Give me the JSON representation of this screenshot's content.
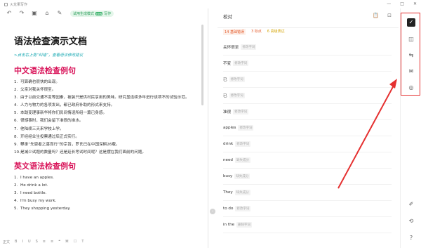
{
  "window": {
    "app_title": "火龙果写作",
    "controls": [
      "—",
      "□",
      "✕"
    ]
  },
  "toolbar": {
    "icons": [
      "undo-icon",
      "redo-icon",
      "image-icon",
      "format-icon",
      "brush-icon"
    ],
    "pill_label": "试用生成模式",
    "pill_badge": "new",
    "pill_suffix": "写作"
  },
  "document": {
    "title": "语法检查演示文档",
    "hint": ">点击右上角“纠错”，查看语法修改建议",
    "section_cn": "中文语法检查例句",
    "cn_items": [
      "可算确也很快的出现。",
      "父亲对我关怀很至。",
      "由于以前交通不变等因素，被装只是供村民享用的美味。研究显连续多年进行该项不的试验示范。",
      "人力与物力的各项发出，都已政府补助的形式来支持。",
      "本践变理事新华将你们民间情谊所组一篇已身感。",
      "很憾事时，我们会留下准很的准水。",
      "他陆续三天来学校上学。",
      "开经经业生投票通过后正式实行。",
      "攀承“先恩者之喜而行”的宗旨，罗氏已在中国深耕26载。",
      "是减少试题的数量吗？还是延长考试时间呢？这是摆在我们面前的问题。"
    ],
    "section_en": "英文语法检查例句",
    "en_items": [
      "I have an apples.",
      "He drink a lot.",
      "I need bottle.",
      "I'm busy my work.",
      "They shopping yesterday."
    ]
  },
  "bottombar": [
    "正文",
    "B",
    "I",
    "U",
    "S",
    "≡",
    "≡",
    "❝",
    "⌘",
    "☐",
    "T"
  ],
  "panel": {
    "title": "校对",
    "stats": [
      {
        "count": "14",
        "label": "基础错误"
      },
      {
        "count": "3",
        "label": "标点"
      },
      {
        "count": "6",
        "label": "高级表达"
      }
    ],
    "items": [
      {
        "word": "关怀很至",
        "tag": "修改字词"
      },
      {
        "word": "不变",
        "tag": "修改字词"
      },
      {
        "word": "已",
        "tag": "修改字词"
      },
      {
        "word": "已",
        "tag": "修改字词"
      },
      {
        "word": "准很",
        "tag": "修改字词"
      },
      {
        "word": "apples",
        "tag": "修改字词"
      },
      {
        "word": "drink",
        "tag": "修改字词"
      },
      {
        "word": "need",
        "tag": "缺失成分"
      },
      {
        "word": "busy",
        "tag": "缺失成分"
      },
      {
        "word": "They",
        "tag": "缺失成分"
      },
      {
        "word": "to do",
        "tag": "修改字词"
      },
      {
        "word": "in the",
        "tag": "删除字词"
      }
    ]
  },
  "rightbar": {
    "icons": [
      "proofread-icon",
      "abc-icon",
      "translate-icon",
      "inbox-icon",
      "compass-icon",
      "edit-doc-icon",
      "sync-icon",
      "help-icon"
    ]
  },
  "colors": {
    "accent_red": "#d9145a",
    "hint_teal": "#1aa9b3",
    "annotation_red": "#e53030"
  }
}
